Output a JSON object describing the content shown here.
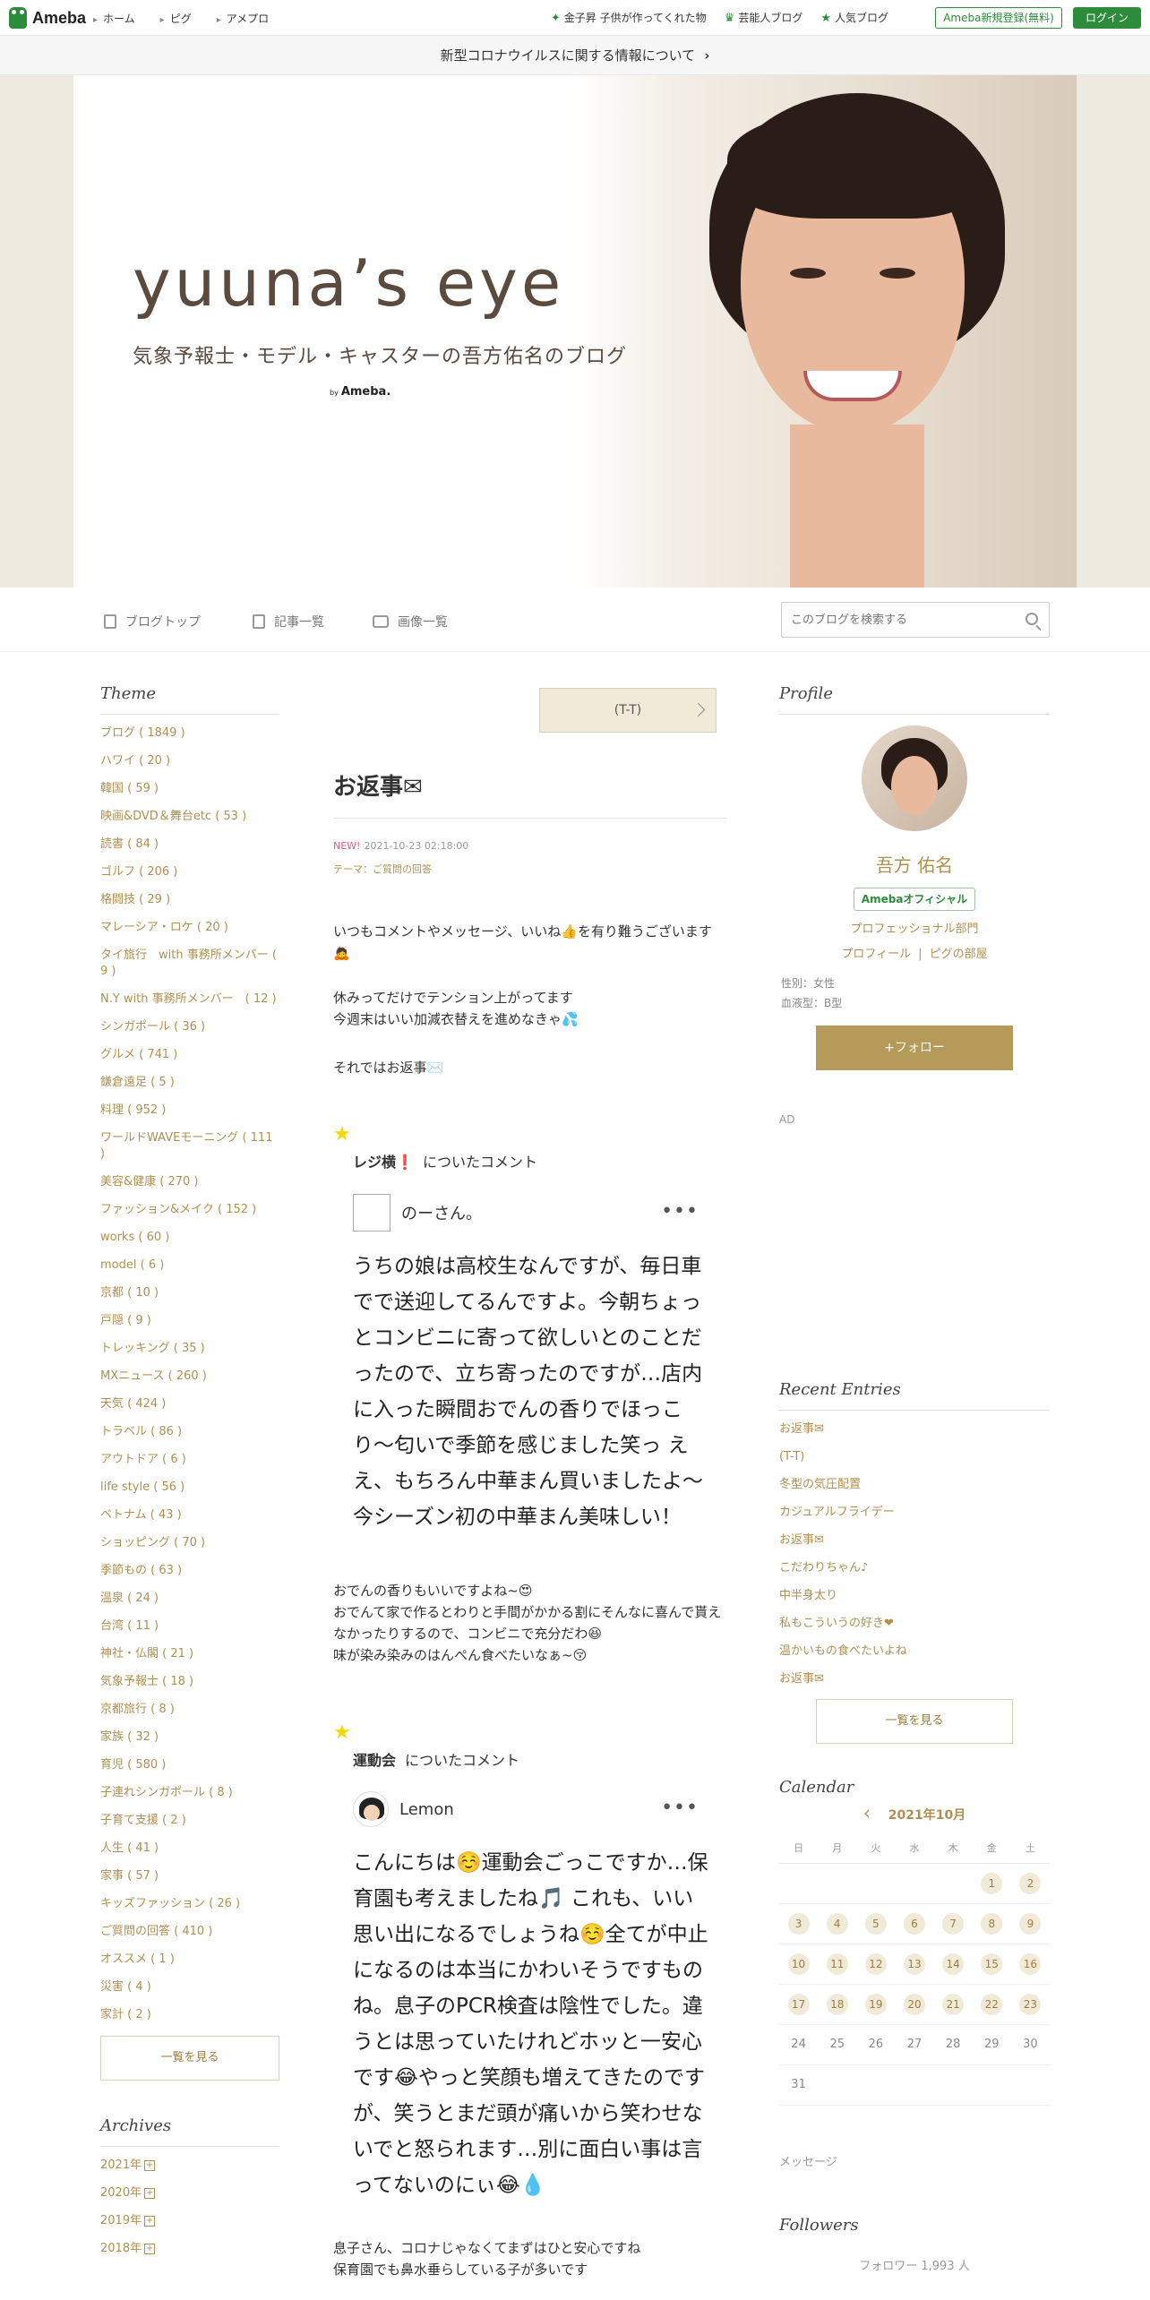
{
  "topbar": {
    "logo": "Ameba",
    "nav": [
      "ホーム",
      "ピグ",
      "アメプロ"
    ],
    "links": [
      "金子昇 子供が作ってくれた物",
      "芸能人ブログ",
      "人気ブログ"
    ],
    "register": "Ameba新規登録(無料)",
    "login": "ログイン"
  },
  "notice": {
    "text": "新型コロナウイルスに関する情報について"
  },
  "hero": {
    "title": "yuuna’s eye",
    "subtitle": "気象予報士・モデル・キャスターの吾方佑名のブログ",
    "by": "by",
    "brand": "Ameba."
  },
  "blognav": {
    "items": [
      "ブログトップ",
      "記事一覧",
      "画像一覧"
    ],
    "search_placeholder": "このブログを検索する"
  },
  "left": {
    "theme_head": "Theme",
    "themes": [
      "ブログ ( 1849 )",
      "ハワイ ( 20 )",
      "韓国 ( 59 )",
      "映画&DVD＆舞台etc ( 53 )",
      "読書 ( 84 )",
      "ゴルフ ( 206 )",
      "格闘技 ( 29 )",
      "マレーシア・ロケ ( 20 )",
      "タイ旅行　with 事務所メンバー ( 9 )",
      "N.Y with 事務所メンバー　( 12 )",
      "シンガポール ( 36 )",
      "グルメ ( 741 )",
      "鎌倉遠足 ( 5 )",
      "料理 ( 952 )",
      "ワールドWAVEモーニング ( 111 )",
      "美容&健康 ( 270 )",
      "ファッション&メイク ( 152 )",
      "works ( 60 )",
      "model ( 6 )",
      "京都 ( 10 )",
      "戸隠 ( 9 )",
      "トレッキング ( 35 )",
      "MXニュース ( 260 )",
      "天気 ( 424 )",
      "トラベル ( 86 )",
      "アウトドア ( 6 )",
      "life style ( 56 )",
      "ベトナム ( 43 )",
      "ショッピング ( 70 )",
      "季節もの ( 63 )",
      "温泉 ( 24 )",
      "台湾 ( 11 )",
      "神社・仏閣 ( 21 )",
      "気象予報士 ( 18 )",
      "京都旅行 ( 8 )",
      "家族 ( 32 )",
      "育児 ( 580 )",
      "子連れシンガポール ( 8 )",
      "子育て支援 ( 2 )",
      "人生 ( 41 )",
      "家事 ( 57 )",
      "キッズファッション ( 26 )",
      "ご質問の回答 ( 410 )",
      "オススメ ( 1 )",
      "災害 ( 4 )",
      "家計 ( 2 )"
    ],
    "more": "一覧を見る",
    "archive_head": "Archives",
    "archives": [
      "2021年",
      "2020年",
      "2019年",
      "2018年"
    ]
  },
  "main": {
    "prev": "(T-T)",
    "title": "お返事✉",
    "new": "NEW!",
    "date": "2021-10-23 02:18:00",
    "theme": "テーマ：ご質問の回答",
    "body": [
      "いつもコメントやメッセージ、いいね👍を有り難うございます🙇",
      "休みってだけでテンション上がってます",
      "今週末はいい加減衣替えを進めなきゃ💦",
      "それではお返事✉️"
    ],
    "c1": {
      "head": "レジ横❗",
      "suffix": "についたコメント",
      "user": "のーさん。",
      "text": "うちの娘は高校生なんですが、毎日車でで送迎してるんですよ。今朝ちょっとコンビニに寄って欲しいとのことだったので、立ち寄ったのですが…店内に入った瞬間おでんの香りでほっこり〜匂いで季節を感じました笑っ ええ、もちろん中華まん買いましたよ〜今シーズン初の中華まん美味しい！",
      "reply": [
        "おでんの香りもいいですよね~😍",
        "おでんて家で作るとわりと手間がかかる割にそんなに喜んで貰えなかったりするので、コンビニで充分だわ😆",
        "味が染み染みのはんぺん食べたいなぁ~😚"
      ]
    },
    "c2": {
      "head": "運動会",
      "suffix": "についたコメント",
      "user": "Lemon",
      "text": "こんにちは☺️運動会ごっこですか…保育園も考えましたね🎵 これも、いい思い出になるでしょうね☺️全てが中止になるのは本当にかわいそうですものね。息子のPCR検査は陰性でした。違うとは思っていたけれどホッと一安心です😂やっと笑顔も増えてきたのですが、笑うとまだ頭が痛いから笑わせないでと怒られます…別に面白い事は言ってないのにぃ😂💧",
      "reply": [
        "息子さん、コロナじゃなくてまずはひと安心ですね",
        "保育園でも鼻水垂らしている子が多いです"
      ]
    }
  },
  "right": {
    "profile_head": "Profile",
    "name": "吾方 佑名",
    "official": "Amebaオフィシャル",
    "category": "プロフェッショナル部門",
    "links": [
      "プロフィール",
      "ピグの部屋"
    ],
    "info": [
      "性別：女性",
      "血液型：B型"
    ],
    "follow": "+フォロー",
    "ad": "AD",
    "recent_head": "Recent Entries",
    "recent": [
      "お返事✉",
      "(T-T)",
      "冬型の気圧配置",
      "カジュアルフライデー",
      "お返事✉",
      "こだわりちゃん♪",
      "中半身太り",
      "私もこういうの好き❤",
      "温かいもの食べたいよね",
      "お返事✉"
    ],
    "more": "一覧を見る",
    "calendar_head": "Calendar",
    "month": "2021年10月",
    "weekdays": [
      "日",
      "月",
      "火",
      "水",
      "木",
      "金",
      "土"
    ],
    "message": "メッセージ",
    "followers_head": "Followers",
    "followers": "フォロワー 1,993 人"
  },
  "colors": {
    "accent": "#b09050",
    "green": "#2d8c3c"
  }
}
